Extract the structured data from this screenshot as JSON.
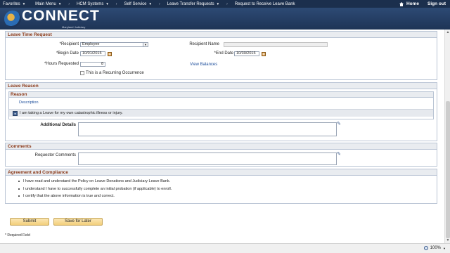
{
  "nav": {
    "items": [
      {
        "label": "Favorites",
        "arrow": "▼"
      },
      {
        "label": "Main Menu",
        "arrow": "▼"
      },
      {
        "label": "HCM Systems",
        "arrow": "▼"
      },
      {
        "label": "Self Service",
        "arrow": "▼"
      },
      {
        "label": "Leave Transfer Requests",
        "arrow": "▼"
      },
      {
        "label": "Request to Receive Leave Bank",
        "arrow": ""
      }
    ],
    "separator": "›",
    "home": "Home",
    "signout": "Sign out"
  },
  "banner": {
    "logo_text": "CONNECT",
    "logo_sub": "Maryland Judiciary"
  },
  "leave_time": {
    "title": "Leave Time Request",
    "recipient_label": "*Recipient",
    "recipient_value": "Employee",
    "recipient_name_label": "Recipient Name",
    "recipient_name_value": "",
    "begin_label": "*Begin Date",
    "begin_value": "10/01/2015",
    "end_label": "*End Date",
    "end_value": "10/30/2015",
    "hours_label": "*Hours Requested",
    "hours_value": "8",
    "view_balances": "View Balances",
    "recurring_label": "This is a Recurring Occurrence"
  },
  "leave_reason": {
    "title": "Leave Reason",
    "sub_title": "Reason",
    "description_header": "Description",
    "reason_text": "I am taking a Leave for my own catastrophic illness or injury.",
    "additional_label": "Additional Details"
  },
  "comments": {
    "title": "Comments",
    "requester_label": "Requester Comments"
  },
  "agreement": {
    "title": "Agreement and Compliance",
    "items": [
      "I have read and understand the Policy on Leave Donations and Judiciary Leave Bank.",
      "I understand I have to successfully complete an initial probation (if applicable) to enroll.",
      "I certify that the above information is true and correct."
    ]
  },
  "actions": {
    "submit": "Submit",
    "save_later": "Save for Later"
  },
  "footer": {
    "required_note": "* Required Field"
  },
  "status": {
    "zoom": "100%"
  }
}
